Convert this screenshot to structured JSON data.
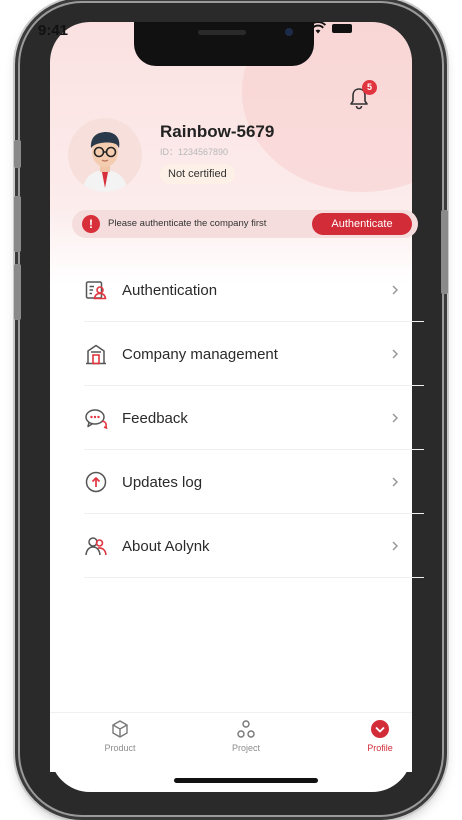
{
  "status_bar": {
    "time": "9:41"
  },
  "notifications": {
    "badge_count": "5"
  },
  "profile": {
    "username": "Rainbow-5679",
    "user_id": "ID：1234567890",
    "certification_status": "Not certified"
  },
  "alert": {
    "message": "Please authenticate the company first",
    "button_label": "Authenticate",
    "icon": "!"
  },
  "menu": {
    "items": [
      {
        "label": "Authentication",
        "icon": "id-card-icon"
      },
      {
        "label": "Company management",
        "icon": "building-icon"
      },
      {
        "label": "Feedback",
        "icon": "chat-bubble-icon"
      },
      {
        "label": "Updates log",
        "icon": "arrow-up-circle-icon"
      },
      {
        "label": "About Aolynk",
        "icon": "users-icon"
      }
    ]
  },
  "tabbar": {
    "tabs": [
      {
        "label": "Product",
        "icon": "cube-icon",
        "active": false
      },
      {
        "label": "Project",
        "icon": "nodes-icon",
        "active": false
      },
      {
        "label": "Profile",
        "icon": "profile-circle-icon",
        "active": true
      }
    ]
  },
  "colors": {
    "accent": "#d22c38",
    "header_gradient_top": "#fbe1e1",
    "alert_background": "#f6dddd",
    "icon_line": "#555555",
    "icon_accent": "#e0353f"
  }
}
